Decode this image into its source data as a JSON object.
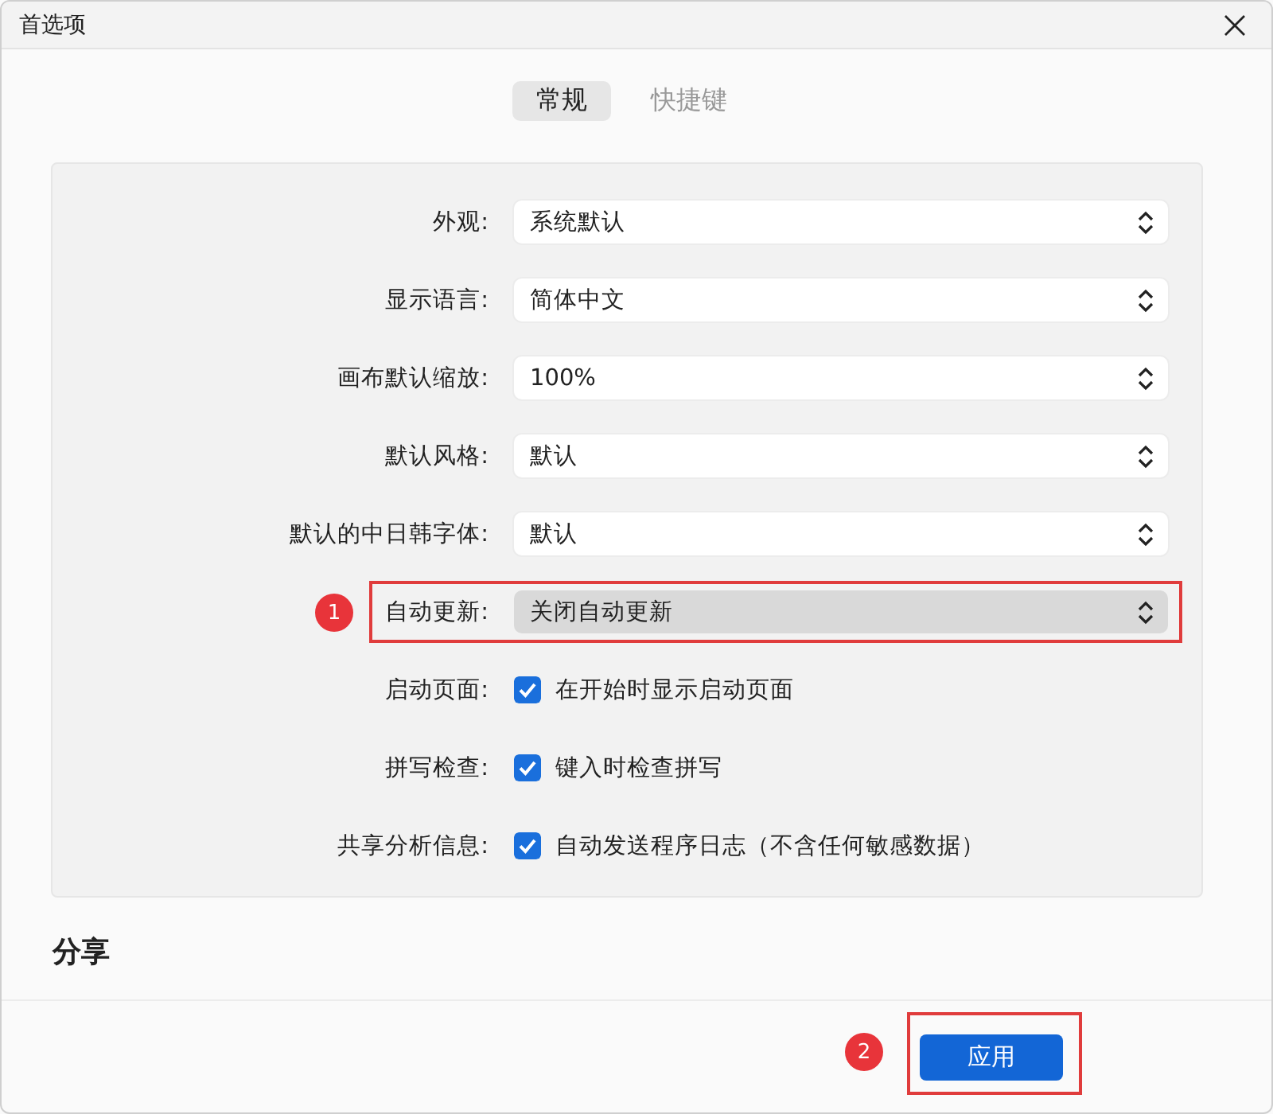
{
  "window": {
    "title": "首选项"
  },
  "tabs": [
    {
      "label": "常规",
      "selected": true
    },
    {
      "label": "快捷键",
      "selected": false
    }
  ],
  "settings": [
    {
      "kind": "select",
      "label": "外观:",
      "value": "系统默认",
      "highlighted": false
    },
    {
      "kind": "select",
      "label": "显示语言:",
      "value": "简体中文",
      "highlighted": false
    },
    {
      "kind": "select",
      "label": "画布默认缩放:",
      "value": "100%",
      "highlighted": false
    },
    {
      "kind": "select",
      "label": "默认风格:",
      "value": "默认",
      "highlighted": false
    },
    {
      "kind": "select",
      "label": "默认的中日韩字体:",
      "value": "默认",
      "highlighted": false
    },
    {
      "kind": "select",
      "label": "自动更新:",
      "value": "关闭自动更新",
      "highlighted": true,
      "annotation": "1"
    },
    {
      "kind": "checkbox",
      "label": "启动页面:",
      "text": "在开始时显示启动页面",
      "checked": true
    },
    {
      "kind": "checkbox",
      "label": "拼写检查:",
      "text": "键入时检查拼写",
      "checked": true
    },
    {
      "kind": "checkbox",
      "label": "共享分析信息:",
      "text": "自动发送程序日志（不含任何敏感数据）",
      "checked": true
    }
  ],
  "section_heading": "分享",
  "apply_button": {
    "label": "应用",
    "annotation": "2"
  }
}
